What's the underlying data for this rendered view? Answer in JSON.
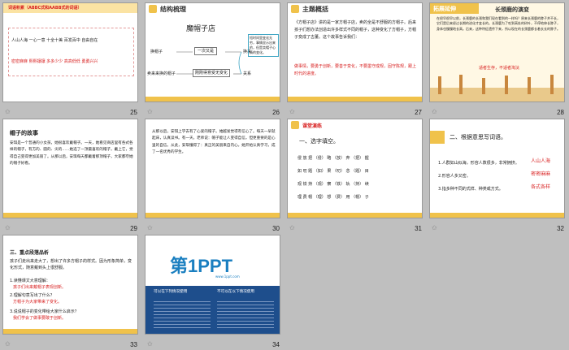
{
  "slides": [
    {
      "num": "25",
      "header": "词语积累（ABBC式和AABB式的词语）",
      "rows": [
        "人山人海  一心一意  十全十美  百发百中  自由自在",
        "密密麻麻  熙熙攘攘  多多少少  高高低低  勇勇兴兴"
      ]
    },
    {
      "num": "26",
      "header": "结构梳理",
      "title": "魔帽子店",
      "nodes": [
        "换帽子",
        "一次又是",
        "换来",
        "卖来来换的帽子",
        "刚刚得意受无变化",
        "关系"
      ],
      "note": "短时间里变化无穷，事情显示出来的，但是卖帽子心情的变化。"
    },
    {
      "num": "27",
      "header": "主题概括",
      "text": "《方帽子店》讲的是一家方帽子店，卖的全是不舒服的方帽子。后来孩子们想办法创造出许多样式不同的帽子，这种变化了方帽子，方帽子变成了古董。这个故事告诉我们：",
      "highlight": "做事情，要勇于创新，要善于变化，不要墨守成规，固守陈规，跟上时代的进度。"
    },
    {
      "num": "28",
      "header": "拓展延伸",
      "title": "长颈鹿的演变",
      "text": "在很早很早以前，长颈鹿的长颈和我们现在看到的一样吗？原来长颈鹿的脖子并不长，它们是后来经过长期的进化才变长的。长颈鹿为了吃到高处的树叶，不停地伸长脖子，身体也慢慢地长高。后来，这种特征遗传下来，所以现在的长颈鹿都长着长长的脖子。",
      "highlight": "适者生存，不适者淘汰"
    },
    {
      "num": "29",
      "title": "帽子的故事",
      "text": "安琪是一个普通的小女孩，她很喜欢戴帽子。一天，她看见商店里有各式各样的帽子，有方的、圆的、尖的……她选了一顶最喜欢的帽子，戴上它，觉得自己变得更加美丽了。从那以后，安琪每天都戴着那顶帽子，大家都夸她的帽子好看。"
    },
    {
      "num": "30",
      "text": "从那以后，安琪上学去有了心爱的帽子。她越发觉得有信心了。每天一早就起床，认真读书。有一天，老师说：帽子能让人变得自信，但更重要的是心里的自信。从此，安琪懂得了：真正的美丽来自内心。她开始认真学习，成了一名优秀的学生。"
    },
    {
      "num": "31",
      "header": "课堂演练",
      "q": "一、选字填空。",
      "rows": [
        "侵 放 把 （侵） 略  （放） 弃  （把） 握",
        "如 叨 题 （如） 果  （叨） 念  （题） 目",
        "观 铁 持 （观） 察  （铁） 轨  （持） 续",
        "理 费 帽 （理） 想  （费） 用  （帽） 子"
      ]
    },
    {
      "num": "32",
      "q": "二、根据意思写词语。",
      "items": [
        "1.人群如山似海，形容人数很多，非常拥挤。",
        "2.形容人多又密。",
        "3.指多种不同的式样、种类或方式。"
      ],
      "answers": [
        "人山人海",
        "密密麻麻",
        "各式各样"
      ]
    },
    {
      "num": "33",
      "q": "三、重点段落品析",
      "text": "孩子们走出来走大了，想出了许多方帽子的样式。因为形象简单，变化形式，随意戴到头上很舒服。",
      "asks": [
        "1.读懂课文大意理解：",
        "2.理解句意写出了什么？",
        "3.说说帽子的变化带给大家什么启示？"
      ],
      "ans": [
        "孩子们出来戴帽子表现创新。",
        "方帽子为大家带来了变化。",
        "我们学会了做事要敢于创新。"
      ]
    },
    {
      "num": "34",
      "logo": "第1PPT",
      "site": "www.1ppt.com",
      "l": "可以在下列情况使用",
      "r": "不可以在以下情况使用"
    }
  ],
  "colors": {
    "accent": "#f0c24b",
    "red": "#d82020",
    "bg": "#bfbfbf"
  }
}
